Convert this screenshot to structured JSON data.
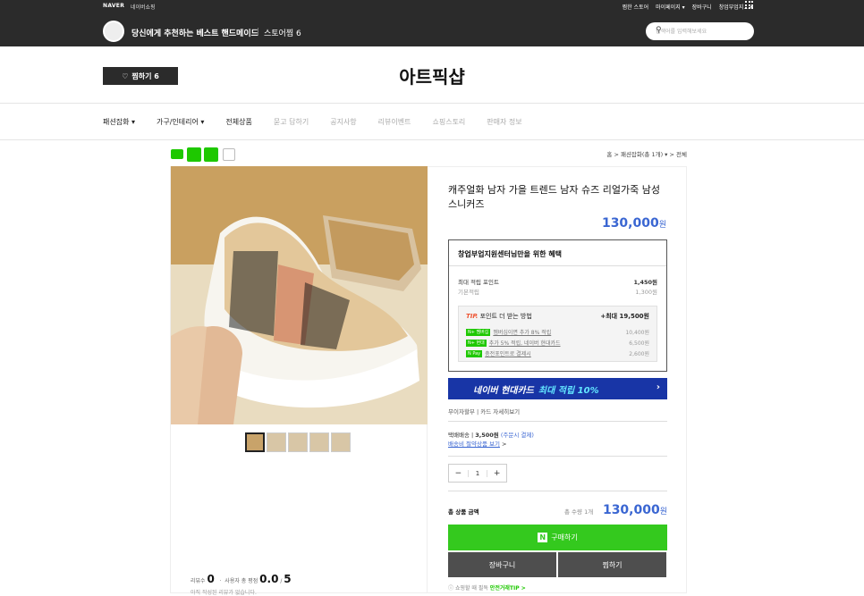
{
  "gnb": {
    "naver": "NAVER",
    "shop": "네이버쇼핑",
    "links": [
      "찜한 스토어",
      "마이페이지 ▾",
      "장바구니",
      "창업부업지... ▾"
    ],
    "store_title": "당신에게 추천하는 베스트 핸드메이드",
    "store_pick": "스토어찜 6",
    "search_placeholder": "검색어를 입력해보세요"
  },
  "header": {
    "jjim_label": "찜하기 6",
    "brand": "아트픽샵"
  },
  "nav": {
    "items": [
      "패션잡화 ▾",
      "가구/인테리어 ▾",
      "전체상품",
      "묻고 답하기",
      "공지사항",
      "리뷰이벤트",
      "쇼핑스토리",
      "판매자 정보"
    ]
  },
  "breadcrumb": "홈 > 패션잡화(총 1개) ▾ > 전체",
  "product": {
    "title": "캐주얼화 남자 가을 트렌드 남자 슈즈 리얼가죽 남성 스니커즈",
    "price": "130,000",
    "currency": "원"
  },
  "benefit": {
    "title": "창업부업지원센터님만을 위한 혜택",
    "point_label": "최대 적립 포인트",
    "point_value": "1,450원",
    "basic_label": "기본적립",
    "basic_value": "1,300원",
    "tip_label": "포인트 더 받는 방법",
    "tip_prefix": "TIP.",
    "tip_value": "+최대 19,500원",
    "tip_rows": [
      {
        "badge": "N+ 멤버십",
        "text": "멤버십이면 추가 8% 적립",
        "value": "10,400원"
      },
      {
        "badge": "N+ 현대",
        "text": "추가 5% 적립, 네이버 현대카드",
        "value": "6,500원"
      },
      {
        "badge": "N Pay",
        "text": "충전포인트로 결제시",
        "value": "2,600원"
      }
    ]
  },
  "card_banner": {
    "text": "네이버 현대카드",
    "highlight": "최대 적립 10%",
    "arrow": "›"
  },
  "installment": "무이자할부 | 카드 자세히보기",
  "shipping": {
    "label": "택배배송",
    "fee": "3,500원",
    "note": "(주문시 결제)",
    "link": "배송비 절약상품 보기"
  },
  "quantity": {
    "minus": "−",
    "value": "1",
    "plus": "+"
  },
  "total": {
    "label": "총 상품 금액",
    "qty": "총 수량 1개",
    "price": "130,000",
    "currency": "원"
  },
  "buttons": {
    "buy": "구매하기",
    "buy_icon": "N",
    "cart": "장바구니",
    "wish": "찜하기"
  },
  "tipline": {
    "text": "쇼핑할 때 필독",
    "link": "안전거래TIP >"
  },
  "reviews": {
    "count_label": "리뷰수",
    "count": "0",
    "rating_label": "사용자 총 평점",
    "rating": "0.0",
    "rating_max": "5",
    "none": "아직 작성된 리뷰가 없습니다."
  },
  "colors": {
    "accent_blue": "#3a66d2",
    "buy_green": "#34c91e",
    "dark_bar": "#2b2b2b",
    "card_navy": "#1835a6"
  }
}
